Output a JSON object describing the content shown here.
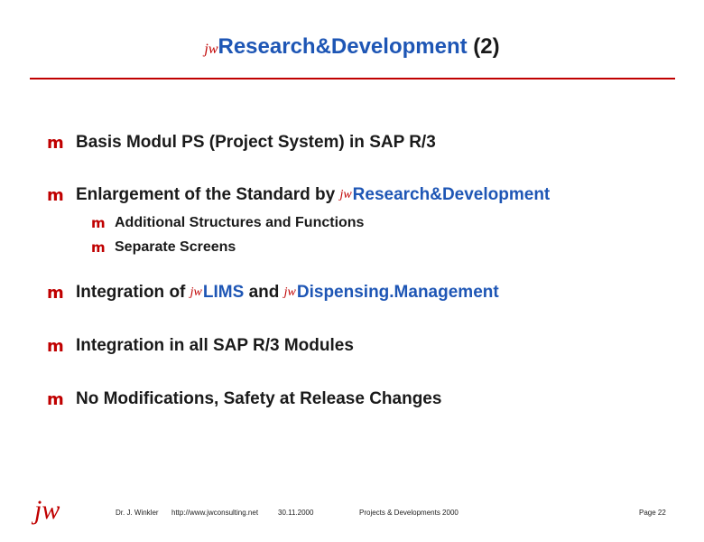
{
  "title": {
    "prefix": "jw",
    "text": "Research&Development",
    "suffix": " (2)"
  },
  "bullets": [
    {
      "parts": [
        {
          "text": "Basis Modul PS (Project System) in SAP R/3"
        }
      ]
    },
    {
      "parts": [
        {
          "text": "Enlargement of the Standard by "
        },
        {
          "jw": "jw"
        },
        {
          "text": "Research&Development",
          "blue": true
        }
      ]
    },
    {
      "parts": [
        {
          "text": "Integration of "
        },
        {
          "jw": "jw"
        },
        {
          "text": "LIMS",
          "blue": true
        },
        {
          "text": " and "
        },
        {
          "jw": "jw"
        },
        {
          "text": "Dispensing.Management",
          "blue": true
        }
      ]
    },
    {
      "parts": [
        {
          "text": "Integration in all SAP R/3 Modules"
        }
      ]
    },
    {
      "parts": [
        {
          "text": "No Modifications, Safety at Release Changes"
        }
      ]
    }
  ],
  "sub_bullets": [
    "Additional Structures and Functions",
    "Separate Screens"
  ],
  "bullet_marker": "m",
  "footer": {
    "logo": "jw",
    "author": "Dr. J. Winkler",
    "url": "http://www.jwconsulting.net",
    "date": "30.11.2000",
    "title": "Projects & Developments 2000",
    "page": "Page 22"
  },
  "colors": {
    "accent_red": "#c00000",
    "link_blue": "#1e56b5",
    "text": "#1a1a1a"
  }
}
